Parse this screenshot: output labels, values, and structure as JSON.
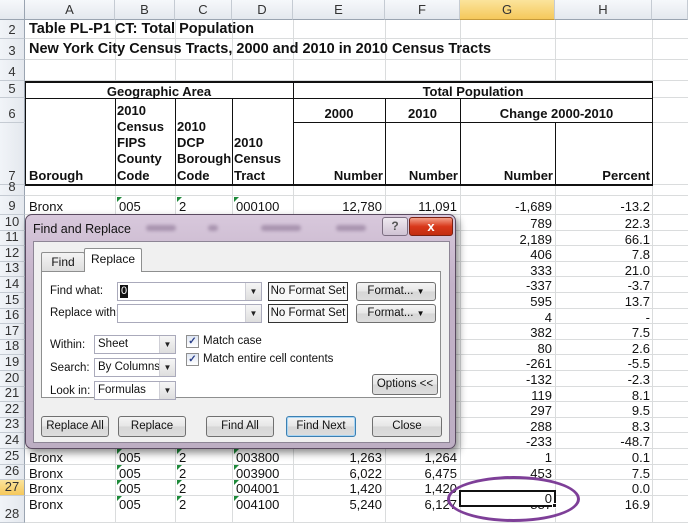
{
  "spreadsheet": {
    "columns": [
      "A",
      "B",
      "C",
      "D",
      "E",
      "F",
      "G",
      "H"
    ],
    "selected_column": "G",
    "selected_row": "27",
    "title_row": {
      "row": "2",
      "text": "Table PL-P1 CT:  Total Population"
    },
    "subtitle_row": {
      "row": "3",
      "text": "New York City Census Tracts, 2000 and 2010 in 2010 Census Tracts"
    },
    "row_numbers": [
      "2",
      "3",
      "4",
      "5",
      "6",
      "7",
      "8",
      "9",
      "10",
      "11",
      "12",
      "13",
      "14",
      "15",
      "16",
      "17",
      "18",
      "19",
      "20",
      "21",
      "22",
      "23",
      "24",
      "25",
      "26",
      "27",
      "28"
    ],
    "headers": {
      "geographic_area": "Geographic Area",
      "total_population": "Total Population",
      "borough": "Borough",
      "fips_line1": "2010",
      "fips_line2": "Census",
      "fips_line3": "FIPS",
      "fips_line4": "County",
      "fips_line5": "Code",
      "dcp_line1": "2010",
      "dcp_line2": "DCP",
      "dcp_line3": "Borough",
      "dcp_line4": "Code",
      "tract_line1": "2010",
      "tract_line2": "Census",
      "tract_line3": "Tract",
      "year2000": "2000",
      "year2010": "2010",
      "change": "Change 2000-2010",
      "number_2000": "Number",
      "number_2010": "Number",
      "number_change": "Number",
      "percent": "Percent"
    },
    "row9": {
      "borough": "Bronx",
      "fips": "005",
      "dcp": "2",
      "tract": "000100",
      "pop2000": "12,780",
      "pop2010": "11,091",
      "change": "-1,689",
      "percent": "-13.2"
    },
    "visible_right_values": [
      {
        "row": "10",
        "change": "789",
        "percent": "22.3"
      },
      {
        "row": "11",
        "change": "2,189",
        "percent": "66.1"
      },
      {
        "row": "12",
        "change": "406",
        "percent": "7.8"
      },
      {
        "row": "13",
        "change": "333",
        "percent": "21.0"
      },
      {
        "row": "14",
        "change": "-337",
        "percent": "-3.7"
      },
      {
        "row": "15",
        "change": "595",
        "percent": "13.7"
      },
      {
        "row": "16",
        "change": "4",
        "percent": "-"
      },
      {
        "row": "17",
        "change": "382",
        "percent": "7.5"
      },
      {
        "row": "18",
        "change": "80",
        "percent": "2.6"
      },
      {
        "row": "19",
        "change": "-261",
        "percent": "-5.5"
      },
      {
        "row": "20",
        "change": "-132",
        "percent": "-2.3"
      },
      {
        "row": "21",
        "change": "119",
        "percent": "8.1"
      },
      {
        "row": "22",
        "change": "297",
        "percent": "9.5"
      },
      {
        "row": "23",
        "change": "288",
        "percent": "8.3"
      },
      {
        "row": "24",
        "change": "-233",
        "percent": "-48.7"
      }
    ],
    "bottom_rows": [
      {
        "row": "25",
        "borough": "Bronx",
        "fips": "005",
        "dcp": "2",
        "tract": "003800",
        "pop2000": "1,263",
        "pop2010": "1,264",
        "change": "1",
        "percent": "0.1"
      },
      {
        "row": "26",
        "borough": "Bronx",
        "fips": "005",
        "dcp": "2",
        "tract": "003900",
        "pop2000": "6,022",
        "pop2010": "6,475",
        "change": "453",
        "percent": "7.5"
      },
      {
        "row": "27",
        "borough": "Bronx",
        "fips": "005",
        "dcp": "2",
        "tract": "004001",
        "pop2000": "1,420",
        "pop2010": "1,420",
        "change": "0",
        "percent": "0.0"
      },
      {
        "row": "28",
        "borough": "Bronx",
        "fips": "005",
        "dcp": "2",
        "tract": "004100",
        "pop2000": "5,240",
        "pop2010": "6,127",
        "change": "887",
        "percent": "16.9"
      }
    ],
    "highlight_color": "#7e3f98"
  },
  "dialog": {
    "title": "Find and Replace",
    "help_label": "?",
    "close_label": "x",
    "tabs": [
      {
        "label": "Find",
        "active": false
      },
      {
        "label": "Replace",
        "active": true
      }
    ],
    "find_what_label": "Find what:",
    "find_what_value": "0",
    "replace_with_label": "Replace with:",
    "replace_with_value": "",
    "no_format_1": "No Format Set",
    "no_format_2": "No Format Set",
    "format_btn_1": "Format...",
    "format_btn_2": "Format...",
    "within_label": "Within:",
    "within_value": "Sheet",
    "search_label": "Search:",
    "search_value": "By Columns",
    "lookin_label": "Look in:",
    "lookin_value": "Formulas",
    "match_case_label": "Match case",
    "match_case_checked": true,
    "match_entire_label": "Match entire cell contents",
    "match_entire_checked": true,
    "options_btn": "Options <<",
    "replace_all_btn": "Replace All",
    "replace_btn": "Replace",
    "find_all_btn": "Find All",
    "find_next_btn": "Find Next",
    "close_btn": "Close"
  }
}
